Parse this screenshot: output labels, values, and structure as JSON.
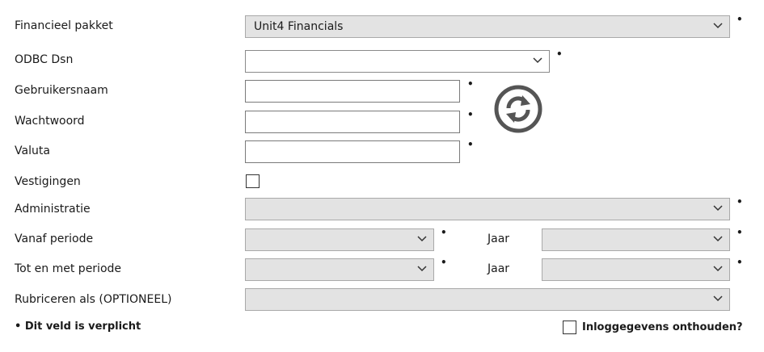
{
  "required_marker": "•",
  "fields": {
    "financial_package": {
      "label": "Financieel pakket",
      "value": "Unit4 Financials"
    },
    "odbc_dsn": {
      "label": "ODBC Dsn",
      "value": ""
    },
    "username": {
      "label": "Gebruikersnaam",
      "value": ""
    },
    "password": {
      "label": "Wachtwoord",
      "value": ""
    },
    "currency": {
      "label": "Valuta",
      "value": ""
    },
    "branches": {
      "label": "Vestigingen",
      "checked": false
    },
    "administration": {
      "label": "Administratie",
      "value": ""
    },
    "from_period": {
      "label": "Vanaf periode",
      "value": "",
      "year_label": "Jaar",
      "year_value": ""
    },
    "to_period": {
      "label": "Tot en met periode",
      "value": "",
      "year_label": "Jaar",
      "year_value": ""
    },
    "classify_as": {
      "label": "Rubriceren als (OPTIONEEL)",
      "value": ""
    }
  },
  "refresh_icon": "refresh-icon",
  "footer": {
    "required_note": "Dit veld is verplicht",
    "remember_label": "Inloggegevens onthouden?",
    "remember_checked": false
  },
  "colors": {
    "disabled_field": "#e3e3e3",
    "icon": "#555555"
  }
}
